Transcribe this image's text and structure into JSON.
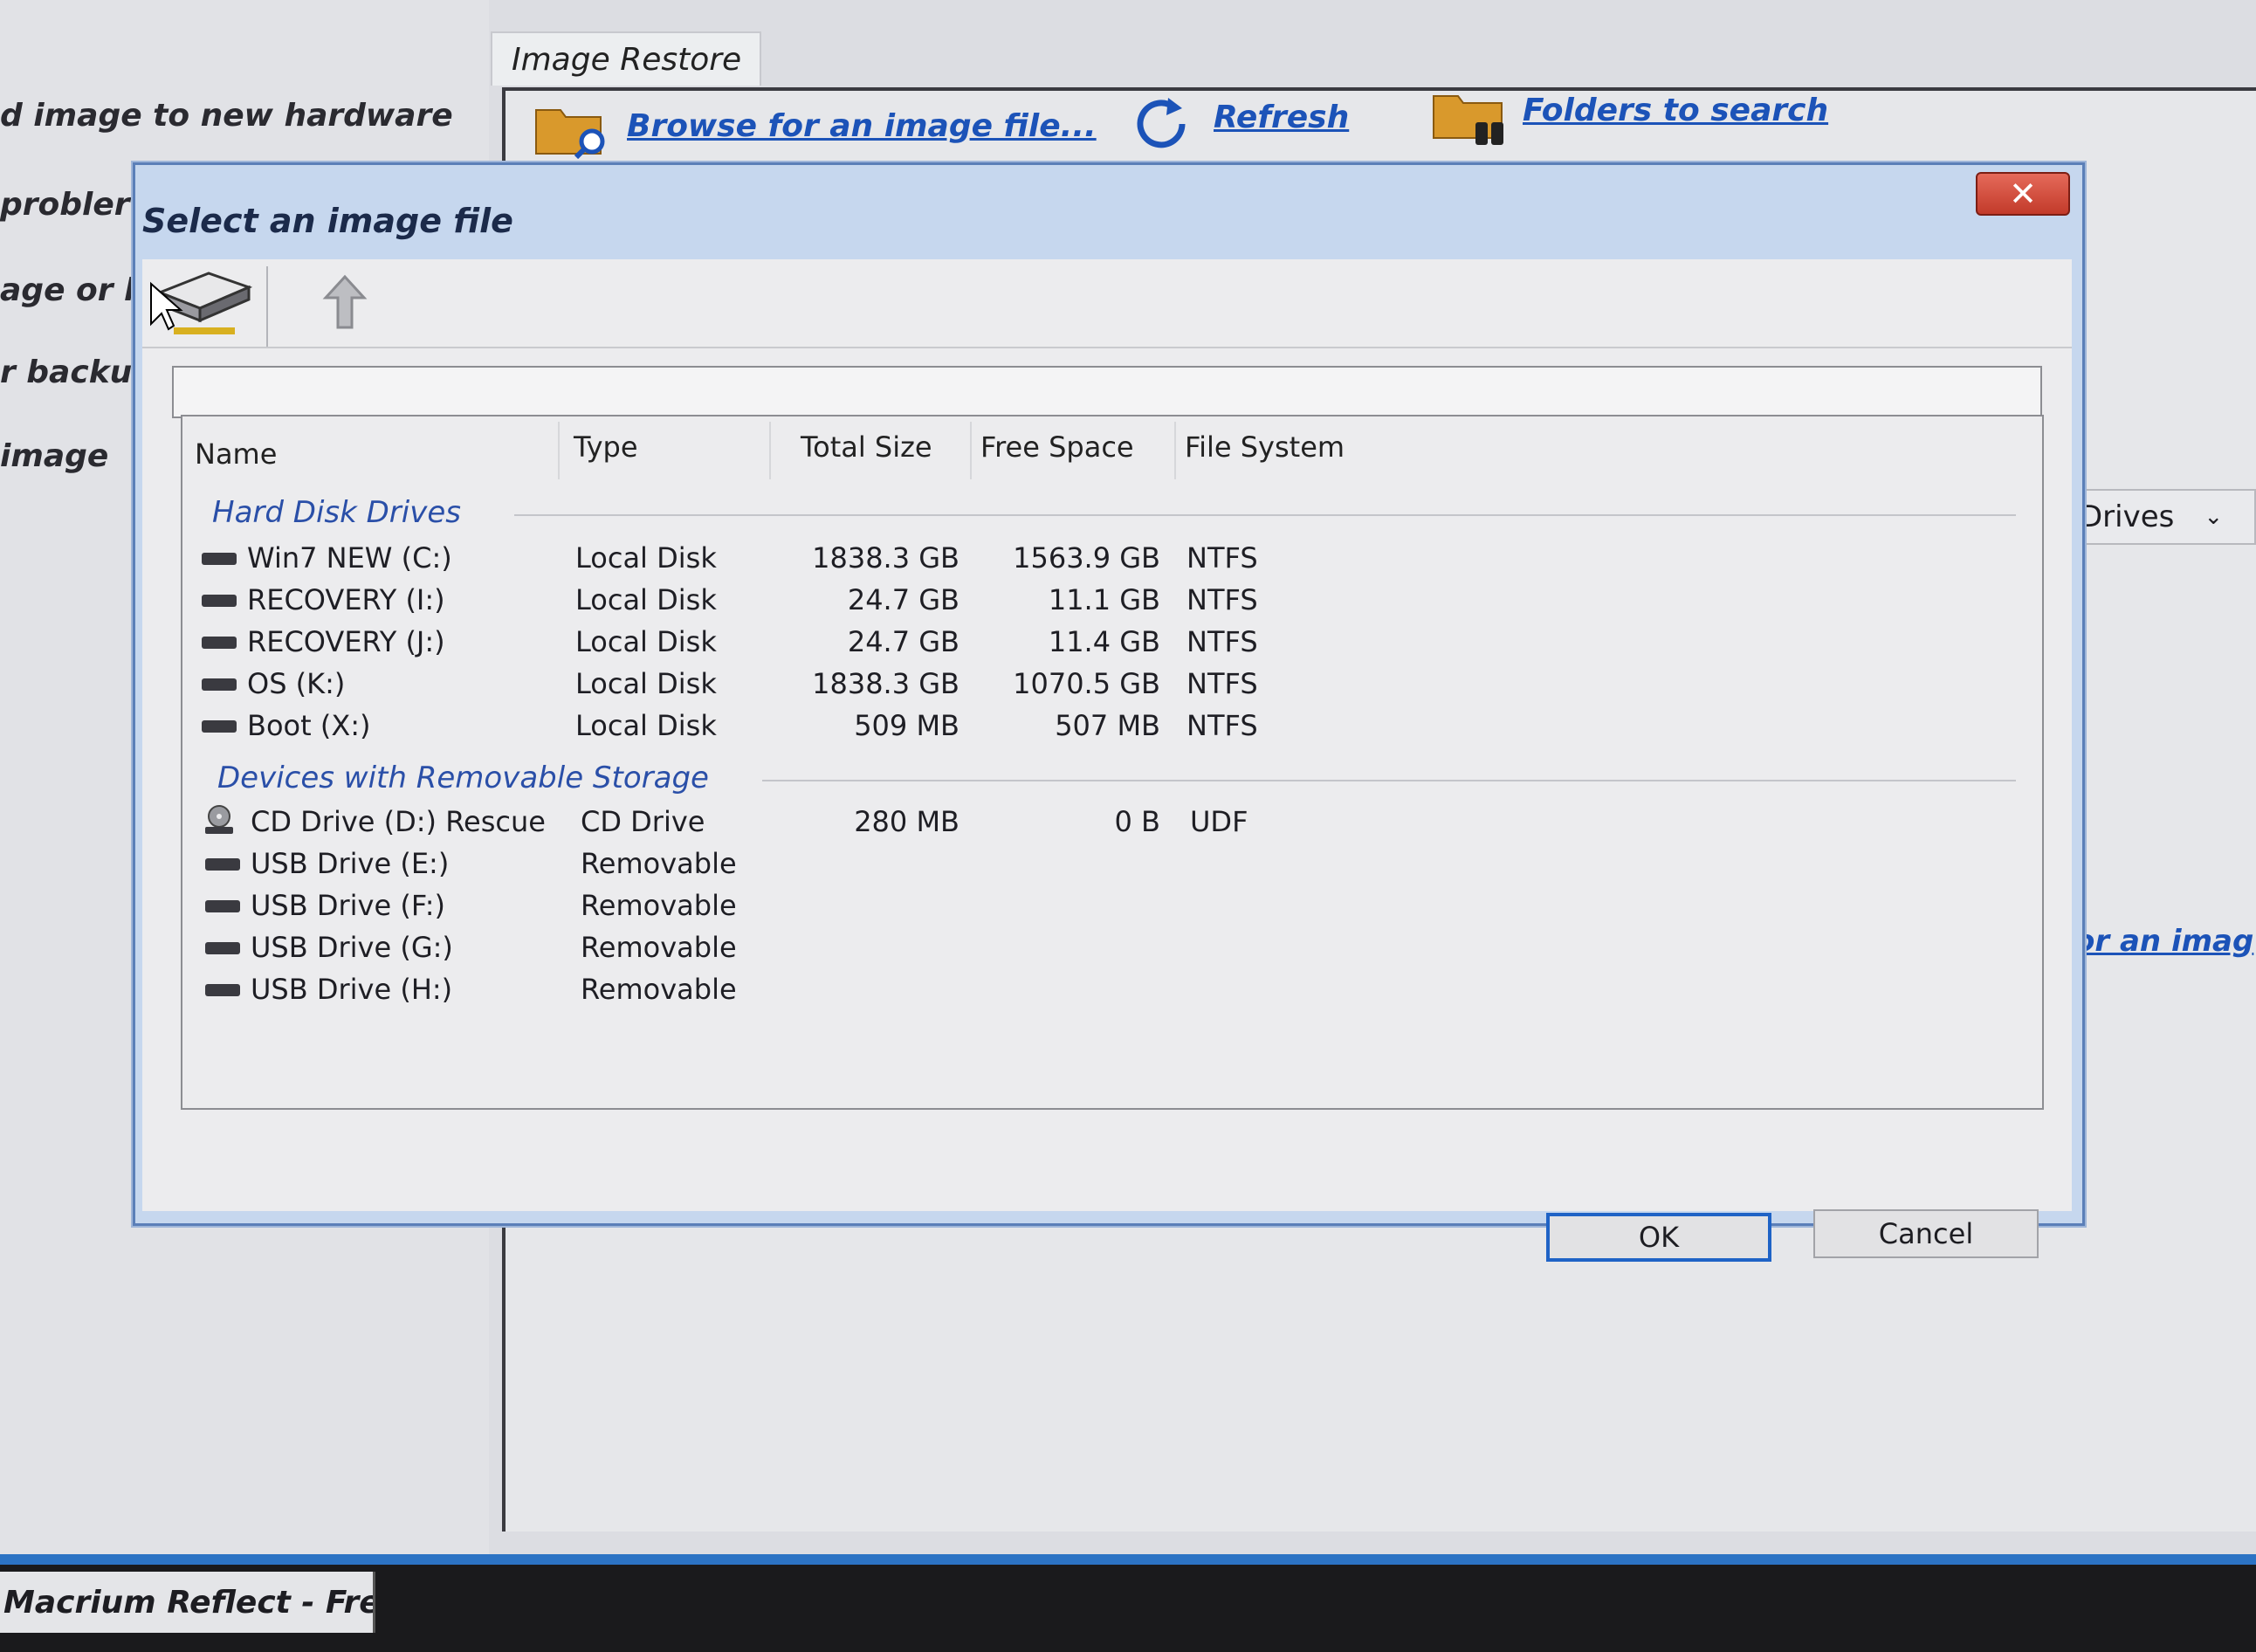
{
  "background": {
    "left_items": [
      "d image to new hardware",
      "probler",
      "age or b",
      "r backu",
      "image"
    ],
    "tab_label": "Image Restore",
    "toolbar": {
      "browse_label": "Browse for an image file...",
      "refresh_label": "Refresh",
      "folders_label": "Folders to search"
    },
    "drives_select": "Drives",
    "image_link": "or an imag",
    "taskbar_item": "Macrium Reflect - Fre..."
  },
  "dialog": {
    "title": "Select an image file",
    "close_label": "✕",
    "columns": {
      "name": "Name",
      "type": "Type",
      "total_size": "Total Size",
      "free_space": "Free Space",
      "file_system": "File System"
    },
    "groups": {
      "hard_disk": "Hard Disk Drives",
      "removable": "Devices with Removable Storage"
    },
    "hard_disks": [
      {
        "name": "Win7 NEW (C:)",
        "type": "Local Disk",
        "total": "1838.3 GB",
        "free": "1563.9 GB",
        "fs": "NTFS"
      },
      {
        "name": "RECOVERY (I:)",
        "type": "Local Disk",
        "total": "24.7 GB",
        "free": "11.1 GB",
        "fs": "NTFS"
      },
      {
        "name": "RECOVERY (J:)",
        "type": "Local Disk",
        "total": "24.7 GB",
        "free": "11.4 GB",
        "fs": "NTFS"
      },
      {
        "name": "OS (K:)",
        "type": "Local Disk",
        "total": "1838.3 GB",
        "free": "1070.5 GB",
        "fs": "NTFS"
      },
      {
        "name": "Boot (X:)",
        "type": "Local Disk",
        "total": "509 MB",
        "free": "507 MB",
        "fs": "NTFS"
      }
    ],
    "removables": [
      {
        "name": "CD Drive (D:) Rescue",
        "type": "CD Drive",
        "total": "280 MB",
        "free": "0 B",
        "fs": "UDF"
      },
      {
        "name": "USB Drive (E:)",
        "type": "Removable",
        "total": "",
        "free": "",
        "fs": ""
      },
      {
        "name": "USB Drive (F:)",
        "type": "Removable",
        "total": "",
        "free": "",
        "fs": ""
      },
      {
        "name": "USB Drive (G:)",
        "type": "Removable",
        "total": "",
        "free": "",
        "fs": ""
      },
      {
        "name": "USB Drive (H:)",
        "type": "Removable",
        "total": "",
        "free": "",
        "fs": ""
      }
    ],
    "ok_label": "OK",
    "cancel_label": "Cancel"
  }
}
